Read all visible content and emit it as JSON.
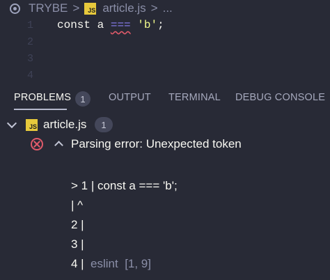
{
  "breadcrumb": {
    "folder": "TRYBE",
    "sep1": ">",
    "file_badge": "JS",
    "file": "article.js",
    "sep2": ">",
    "more": "..."
  },
  "editor": {
    "lines": [
      {
        "num": "1",
        "kw": "const",
        "var": "a",
        "op": "===",
        "str": "'b'",
        "end": ";"
      },
      {
        "num": "2"
      },
      {
        "num": "3"
      },
      {
        "num": "4"
      }
    ]
  },
  "panel": {
    "tabs": [
      "PROBLEMS",
      "OUTPUT",
      "TERMINAL",
      "DEBUG CONSOLE"
    ],
    "problems_count": "1"
  },
  "problems": {
    "file_badge": "JS",
    "file": "article.js",
    "file_count": "1",
    "message": "Parsing error: Unexpected token",
    "details": [
      "> 1 | const a === 'b';",
      "| ^",
      "2 |",
      "3 |",
      "4 |"
    ],
    "source": "eslint",
    "position": "[1, 9]"
  },
  "colors": {
    "background": "#282a36",
    "error": "#e05a6a",
    "string": "#f1fa8c",
    "operator": "#8a7ff5",
    "js_badge": "#e7c93c"
  }
}
